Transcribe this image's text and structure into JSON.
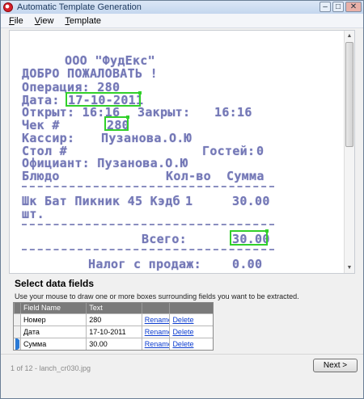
{
  "window": {
    "title": "Automatic Template Generation"
  },
  "menu": [
    {
      "key": "F",
      "rest": "ile"
    },
    {
      "key": "V",
      "rest": "iew"
    },
    {
      "key": "T",
      "rest": "emplate"
    }
  ],
  "receipt": {
    "company": "ООО \"ФудЕкс\"",
    "welcome": "ДОБРО ПОЖАЛОВАТЬ !",
    "operation": "Операция: 280",
    "date_label": "Дата:",
    "date_value": "17-10-2011",
    "opened": "Открыт: 16:16",
    "closed": "Закрыт:",
    "closed_time": "16:16",
    "check_label": "Чек #",
    "check_value": "280",
    "cashier": "Кассир:",
    "cashier_name": "Пузанова.О.Ю",
    "table": "Стол #",
    "guests": "Гостей:",
    "guests_value": "0",
    "waiter": "Официант: Пузанова.О.Ю",
    "col_dish": "Блюдо",
    "col_qty": "Кол-во",
    "col_sum": "Сумма",
    "item_name": "Шк Бат Пикник 45 Кэдб",
    "item_qty": "1",
    "item_sum": "30.00",
    "item_unit": "шт.",
    "total_label": "Всего:",
    "total_value": "30.00",
    "tax_label": "Налог с продаж:",
    "tax_value": "0.00"
  },
  "fields_panel": {
    "title": "Select data fields",
    "instructions": "Use your mouse to draw one or more boxes surrounding fields you want to be extracted.",
    "columns": [
      "Field Name",
      "Text"
    ],
    "rows": [
      {
        "name": "Номер",
        "text": "280",
        "rename": "Rename",
        "delete": "Delete"
      },
      {
        "name": "Дата",
        "text": "17-10-2011",
        "rename": "Rename",
        "delete": "Delete"
      },
      {
        "name": "Сумма",
        "text": "30.00",
        "rename": "Rename",
        "delete": "Delete"
      }
    ]
  },
  "status": {
    "file": "1 of 12 - lanch_cr030.jpg"
  },
  "buttons": {
    "next": "Next >"
  },
  "icons": {
    "app": "app-logo-icon",
    "scroll_up": "arrow-up-icon",
    "scroll_down": "arrow-down-icon"
  }
}
